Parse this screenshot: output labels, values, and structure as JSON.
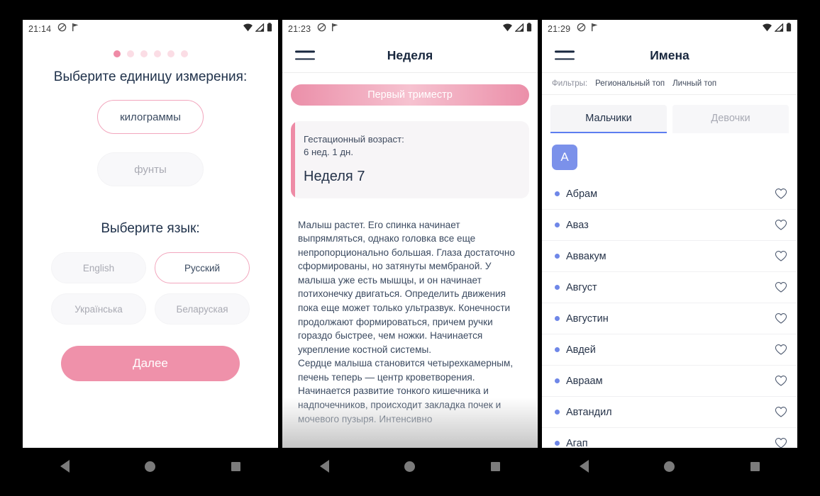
{
  "colors": {
    "pink_accent": "#ef91aa",
    "pink_border": "#f2a6bd",
    "pink_dot_active": "#ef8ba6",
    "pink_dot_inactive": "#fbdde5",
    "dark_text": "#20324b",
    "muted_text": "#a9aab3",
    "blue_accent": "#5d7df0",
    "letter_badge": "#7b91ea"
  },
  "phone1": {
    "statusbar": {
      "time": "21:14",
      "left_icons": [
        "do-not-disturb-icon",
        "flag-icon"
      ],
      "right_icons": [
        "wifi-icon",
        "signal-icon",
        "battery-icon"
      ]
    },
    "pager": {
      "total": 6,
      "active_index": 0
    },
    "unit_title": "Выберите единицу измерения:",
    "units": [
      {
        "label": "килограммы",
        "selected": true
      },
      {
        "label": "фунты",
        "selected": false
      }
    ],
    "language_title": "Выберите язык:",
    "languages": [
      {
        "label": "English",
        "selected": false
      },
      {
        "label": "Русский",
        "selected": true
      },
      {
        "label": "Українська",
        "selected": false
      },
      {
        "label": "Беларуская",
        "selected": false
      }
    ],
    "next_button": "Далее"
  },
  "phone2": {
    "statusbar": {
      "time": "21:23",
      "left_icons": [
        "do-not-disturb-icon",
        "flag-icon"
      ],
      "right_icons": [
        "wifi-icon",
        "signal-icon",
        "battery-icon"
      ]
    },
    "appbar": {
      "menu_icon": "hamburger-icon",
      "title": "Неделя"
    },
    "trimester": "Первый триместр",
    "gestational": {
      "label": "Гестационный возраст:",
      "value": "6 нед. 1 дн.",
      "week": "Неделя 7"
    },
    "article": "Малыш растет. Его спинка начинает выпрямляться, однако головка все еще непропорционально большая. Глаза достаточно сформированы, но затянуты мембраной. У малыша уже есть мышцы, и он начинает потихонечку двигаться. Определить движения пока еще может только ультразвук. Конечности продолжают формироваться, причем ручки гораздо быстрее, чем ножки. Начинается укрепление костной системы.\nСердце малыша становится четырехкамерным, печень теперь — центр кроветворения. Начинается развитие тонкого кишечника и надпочечников, происходит закладка почек и мочевого пузыря. Интенсивно",
    "prev_icon": "chevron-left-icon",
    "next_icon": "chevron-right-icon"
  },
  "phone3": {
    "statusbar": {
      "time": "21:29",
      "left_icons": [
        "do-not-disturb-icon",
        "flag-icon"
      ],
      "right_icons": [
        "wifi-icon",
        "signal-icon",
        "battery-icon"
      ]
    },
    "appbar": {
      "menu_icon": "hamburger-icon",
      "title": "Имена"
    },
    "filters": {
      "label": "Фильтры:",
      "options": [
        "Региональный топ",
        "Личный топ"
      ]
    },
    "tabs": [
      {
        "label": "Мальчики",
        "active": true
      },
      {
        "label": "Девочки",
        "active": false
      }
    ],
    "letter_group": "А",
    "names": [
      {
        "name": "Абрам",
        "favorite": false
      },
      {
        "name": "Аваз",
        "favorite": false
      },
      {
        "name": "Аввакум",
        "favorite": false
      },
      {
        "name": "Август",
        "favorite": false
      },
      {
        "name": "Августин",
        "favorite": false
      },
      {
        "name": "Авдей",
        "favorite": false
      },
      {
        "name": "Авраам",
        "favorite": false
      },
      {
        "name": "Автандил",
        "favorite": false
      },
      {
        "name": "Агап",
        "favorite": false
      }
    ]
  },
  "navbar": {
    "back": "back-triangle-icon",
    "home": "home-circle-icon",
    "recents": "recents-square-icon"
  }
}
